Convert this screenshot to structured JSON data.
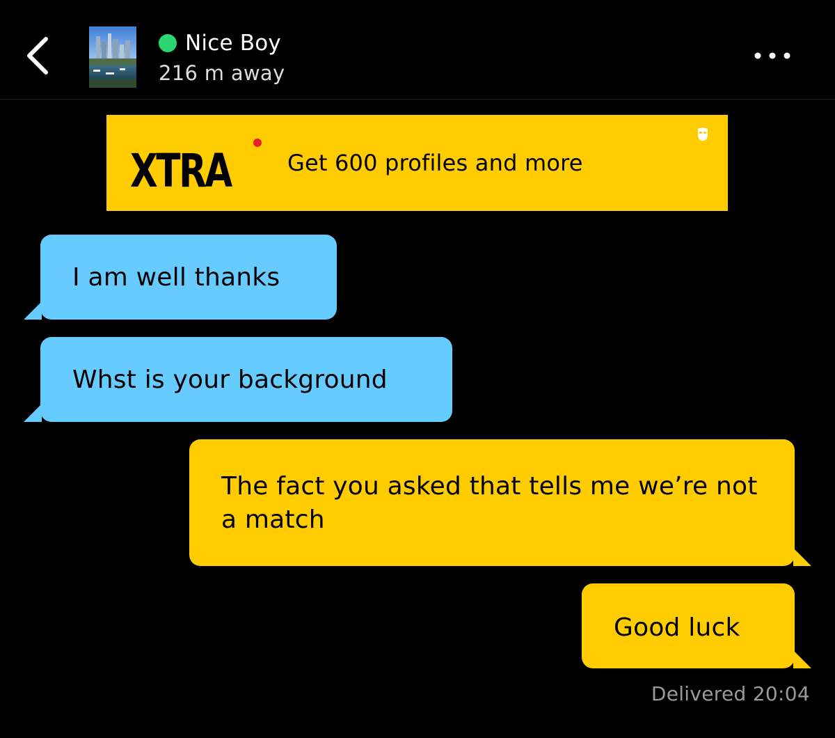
{
  "header": {
    "back_icon": "chevron-left-icon",
    "profile": {
      "name": "Nice Boy",
      "distance": "216 m away",
      "online": true,
      "online_color": "#2bd66e",
      "avatar": "city-skyline-photo"
    },
    "more_icon": "more-horizontal-icon"
  },
  "promo": {
    "logo_text": "XTRA",
    "text": "Get 600 profiles and more",
    "background": "#ffcc00",
    "corner_icon": "mask-icon"
  },
  "messages": [
    {
      "direction": "received",
      "text": "I am well thanks"
    },
    {
      "direction": "received",
      "text": "Whst is your background"
    },
    {
      "direction": "sent",
      "text": "The fact you asked that tells me we’re not a match"
    },
    {
      "direction": "sent",
      "text": "Good luck"
    }
  ],
  "status": {
    "delivered": "Delivered",
    "time": "20:04"
  },
  "colors": {
    "background": "#000000",
    "received_bubble": "#66ccff",
    "sent_bubble": "#ffcc00",
    "muted_text": "#9a9a9a"
  }
}
